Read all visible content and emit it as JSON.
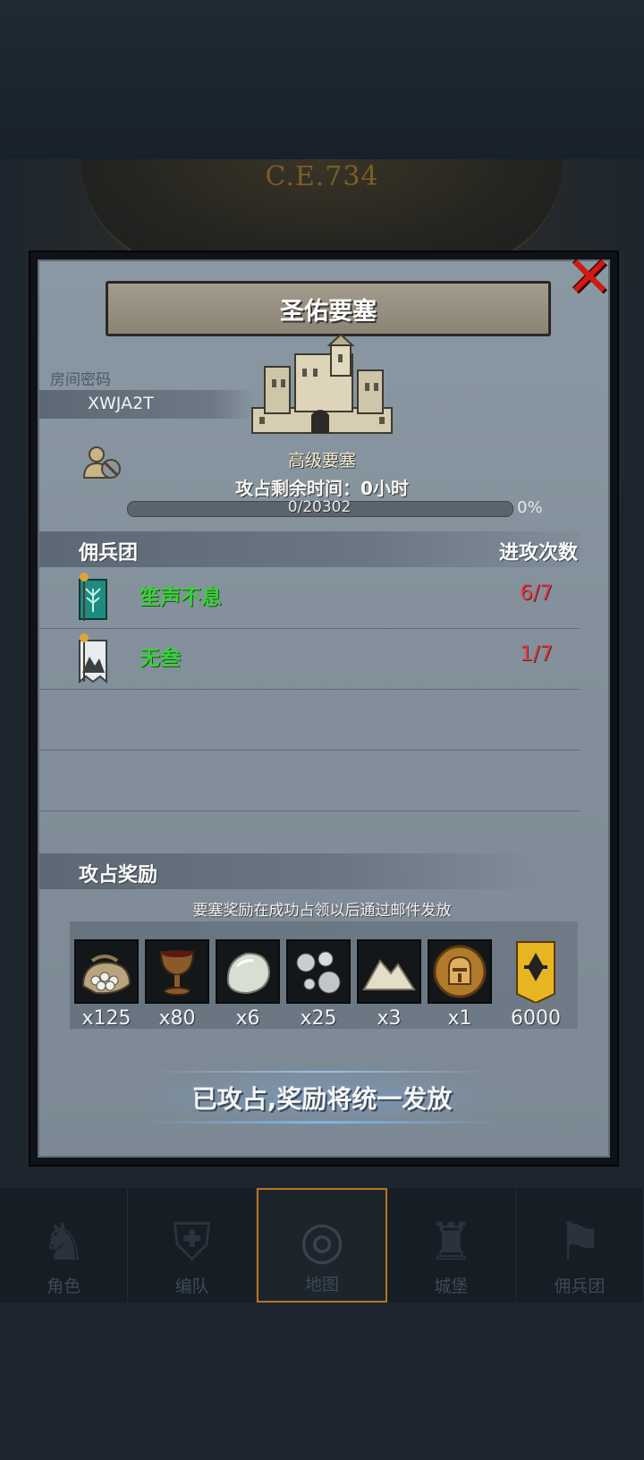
{
  "map": {
    "year": "C.E.734"
  },
  "dialog": {
    "title": "圣佑要塞",
    "room_password_label": "房间密码",
    "room_password": "XWJA2T",
    "fortress_type": "高级要塞",
    "time_remaining": "攻占剩余时间：0小时",
    "progress_text": "0/20302",
    "progress_percent": "0%",
    "progress_value": 0
  },
  "mercenary_table": {
    "col_name": "佣兵团",
    "col_attacks": "进攻次数",
    "rows": [
      {
        "name": "笙声不息",
        "attacks": "6/7",
        "banner_icon": "teal-tree-banner-icon"
      },
      {
        "name": "无叁",
        "attacks": "1/7",
        "banner_icon": "white-mountain-banner-icon"
      }
    ]
  },
  "rewards": {
    "title": "攻占奖励",
    "note": "要塞奖励在成功占领以后通过邮件发放",
    "items": [
      {
        "icon": "ore-sack-icon",
        "qty": "x125"
      },
      {
        "icon": "goblet-icon",
        "qty": "x80"
      },
      {
        "icon": "pale-stone-icon",
        "qty": "x6"
      },
      {
        "icon": "silver-orbs-icon",
        "qty": "x25"
      },
      {
        "icon": "salt-pile-icon",
        "qty": "x3"
      },
      {
        "icon": "knight-helmet-coin-icon",
        "qty": "x1"
      },
      {
        "icon": "guild-badge-icon",
        "qty": "6000"
      }
    ]
  },
  "status": "已攻占,奖励将统一发放",
  "nav": {
    "tabs": [
      {
        "label": "角色",
        "icon": "character-icon",
        "active": false
      },
      {
        "label": "编队",
        "icon": "formation-icon",
        "active": false
      },
      {
        "label": "地图",
        "icon": "map-icon",
        "active": true
      },
      {
        "label": "城堡",
        "icon": "castle-icon",
        "active": false
      },
      {
        "label": "佣兵团",
        "icon": "mercenary-icon",
        "active": false
      }
    ]
  },
  "colors": {
    "mercenary_name": "#3ad23a",
    "attack_count": "#e0414a",
    "close_button": "#d11a12",
    "active_tab_border": "#b8741e"
  }
}
